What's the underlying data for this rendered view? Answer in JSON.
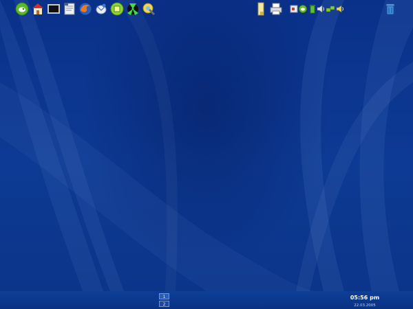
{
  "panel": {
    "launchers": [
      "kmenu-icon",
      "home-folder-icon",
      "terminal-icon",
      "text-editor-icon",
      "firefox-icon",
      "mail-client-icon",
      "control-center-icon",
      "network-icon",
      "system-tools-icon"
    ],
    "pager": {
      "desktops": [
        "1",
        "2"
      ],
      "active": "1"
    },
    "right_launchers": [
      "file-manager-icon",
      "printer-icon"
    ],
    "tray": [
      "hardware-icon",
      "suse-updater-icon",
      "trash-icon",
      "volume-icon",
      "network-status-icon",
      "speaker-icon"
    ],
    "clock": {
      "time": "05:56 pm",
      "date": "22.03.2005"
    },
    "trash_applet": "trash-can-icon"
  },
  "colors": {
    "desktop": "#0b3588",
    "panel": "#0c3a8f",
    "accent": "#6fbf2a"
  }
}
